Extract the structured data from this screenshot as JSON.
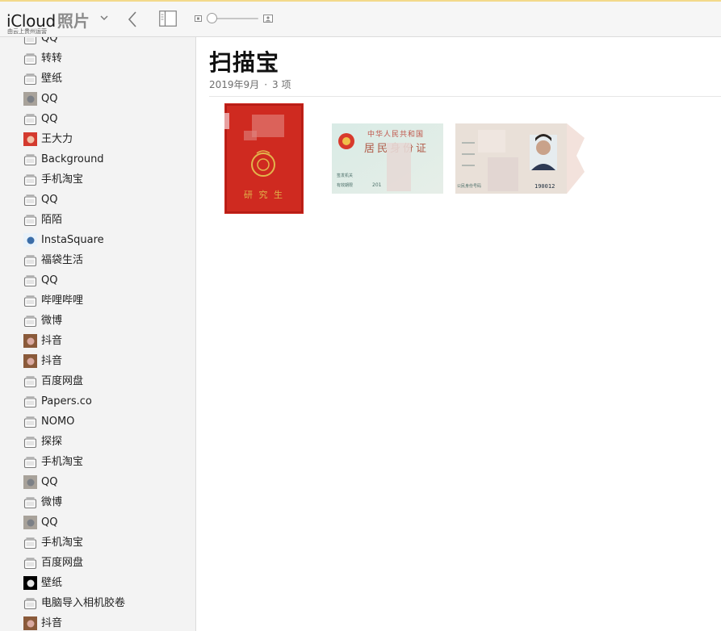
{
  "app": {
    "brand": "iCloud",
    "section": "照片",
    "subtitle": "由云上贵州运营"
  },
  "sidebar": {
    "items": [
      {
        "label": "QQ",
        "icon": "album-icon"
      },
      {
        "label": "转转",
        "icon": "album-icon"
      },
      {
        "label": "壁纸",
        "icon": "album-icon"
      },
      {
        "label": "QQ",
        "icon": "photo-thumbnail-icon"
      },
      {
        "label": "QQ",
        "icon": "album-icon"
      },
      {
        "label": "王大力",
        "icon": "photo-thumbnail-icon"
      },
      {
        "label": "Background",
        "icon": "album-icon"
      },
      {
        "label": "手机淘宝",
        "icon": "album-icon"
      },
      {
        "label": "QQ",
        "icon": "album-icon"
      },
      {
        "label": "陌陌",
        "icon": "album-icon"
      },
      {
        "label": "InstaSquare",
        "icon": "photo-thumbnail-icon"
      },
      {
        "label": "福袋生活",
        "icon": "album-icon"
      },
      {
        "label": "QQ",
        "icon": "album-icon"
      },
      {
        "label": "哔哩哔哩",
        "icon": "album-icon"
      },
      {
        "label": "微博",
        "icon": "album-icon"
      },
      {
        "label": "抖音",
        "icon": "photo-thumbnail-icon"
      },
      {
        "label": "抖音",
        "icon": "photo-thumbnail-icon"
      },
      {
        "label": "百度网盘",
        "icon": "album-icon"
      },
      {
        "label": "Papers.co",
        "icon": "album-icon"
      },
      {
        "label": "NOMO",
        "icon": "album-icon"
      },
      {
        "label": "探探",
        "icon": "album-icon"
      },
      {
        "label": "手机淘宝",
        "icon": "album-icon"
      },
      {
        "label": "QQ",
        "icon": "photo-thumbnail-icon"
      },
      {
        "label": "微博",
        "icon": "album-icon"
      },
      {
        "label": "QQ",
        "icon": "photo-thumbnail-icon"
      },
      {
        "label": "手机淘宝",
        "icon": "album-icon"
      },
      {
        "label": "百度网盘",
        "icon": "album-icon"
      },
      {
        "label": "壁纸",
        "icon": "photo-thumbnail-icon"
      },
      {
        "label": "电脑导入相机胶卷",
        "icon": "album-icon"
      },
      {
        "label": "抖音",
        "icon": "photo-thumbnail-icon"
      }
    ]
  },
  "album": {
    "title": "扫描宝",
    "date": "2019年9月",
    "separator": "·",
    "count": "3 项"
  },
  "photos": [
    {
      "subject": "red-certificate-booklet",
      "cover_text": "研 究 生"
    },
    {
      "subject": "id-card-front",
      "header": "中华人民共和国",
      "title": "居民身份证",
      "field_1": "签发机关",
      "field_2": "有效期限",
      "validity_start": "201"
    },
    {
      "subject": "id-card-back",
      "field_1": "公民身份号码",
      "id_tail": "190012"
    }
  ],
  "colors": {
    "toolbar_bg": "#f6f6f6",
    "sidebar_bg": "#f3f3f3",
    "brand_secondary": "#8b8b8b",
    "booklet_red": "#d0271e",
    "gold": "#e0b44a"
  }
}
